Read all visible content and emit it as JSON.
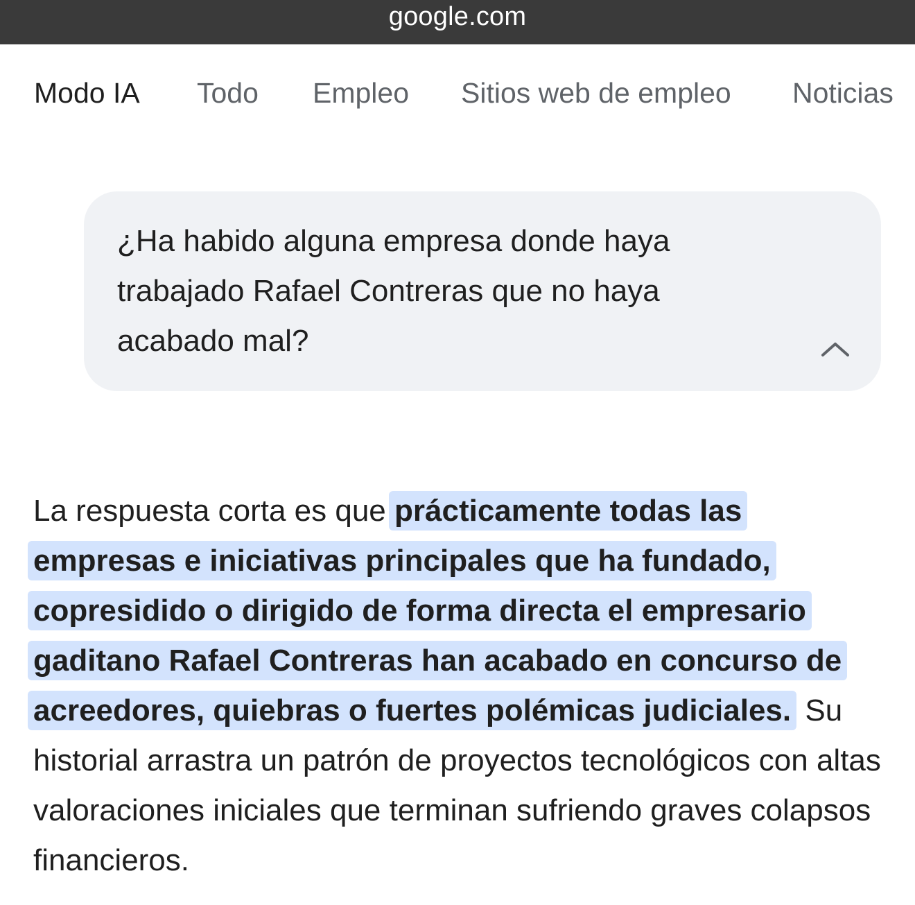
{
  "browser": {
    "url": "google.com"
  },
  "tabs": [
    {
      "label": "Modo IA",
      "active": true
    },
    {
      "label": "Todo",
      "active": false
    },
    {
      "label": "Empleo",
      "active": false
    },
    {
      "label": "Sitios web de empleo",
      "active": false
    },
    {
      "label": "Noticias",
      "active": false
    }
  ],
  "query": {
    "text": "¿Ha habido alguna empresa donde haya trabajado Rafael Contreras que no haya acabado mal?",
    "collapse_icon": "chevron-up-icon"
  },
  "answer": {
    "intro": "La respuesta corta es que ",
    "highlight": "prácticamente todas las empresas e iniciativas principales que ha fundado, copresidido o dirigido de forma directa el empresario gaditano Rafael Contreras han acabado en concurso de acreedores, quiebras o fuertes polémicas judiciales.",
    "rest": " Su historial arrastra un patrón de proyectos tecnológicos con altas valoraciones iniciales que terminan sufriendo graves colapsos financieros."
  },
  "colors": {
    "url_bar_bg": "#3a3a3a",
    "highlight_bg": "#d3e3fd",
    "bubble_bg": "#f0f2f5",
    "tab_inactive": "#5f6368",
    "text": "#1f1f1f"
  }
}
